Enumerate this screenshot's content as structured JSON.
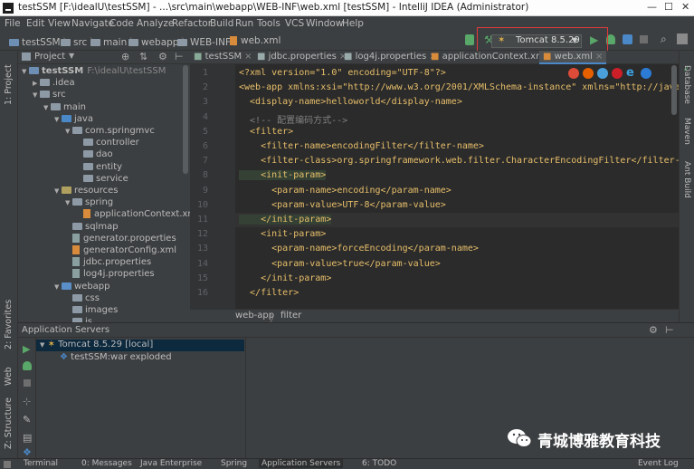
{
  "window": {
    "title": "testSSM [F:\\idealU\\testSSM] - ...\\src\\main\\webapp\\WEB-INF\\web.xml [testSSM] - IntelliJ IDEA (Administrator)"
  },
  "menu": [
    "File",
    "Edit",
    "View",
    "Navigate",
    "Code",
    "Analyze",
    "Refactor",
    "Build",
    "Run",
    "Tools",
    "VCS",
    "Window",
    "Help"
  ],
  "breadcrumbs": [
    "testSSM",
    "src",
    "main",
    "webapp",
    "WEB-INF",
    "web.xml"
  ],
  "run_config": {
    "label": "Tomcat 8.5.29"
  },
  "project_panel": {
    "title": "Project",
    "tree": [
      {
        "label": "testSSM",
        "suffix": "F:\\idealU\\testSSM",
        "indent": 0,
        "kind": "module",
        "open": true
      },
      {
        "label": ".idea",
        "indent": 1,
        "kind": "folder",
        "open": false
      },
      {
        "label": "src",
        "indent": 1,
        "kind": "folder",
        "open": true
      },
      {
        "label": "main",
        "indent": 2,
        "kind": "folder",
        "open": true
      },
      {
        "label": "java",
        "indent": 3,
        "kind": "src",
        "open": true
      },
      {
        "label": "com.springmvc",
        "indent": 4,
        "kind": "package",
        "open": true
      },
      {
        "label": "controller",
        "indent": 5,
        "kind": "package"
      },
      {
        "label": "dao",
        "indent": 5,
        "kind": "package"
      },
      {
        "label": "entity",
        "indent": 5,
        "kind": "package"
      },
      {
        "label": "service",
        "indent": 5,
        "kind": "package"
      },
      {
        "label": "resources",
        "indent": 3,
        "kind": "res",
        "open": true
      },
      {
        "label": "spring",
        "indent": 4,
        "kind": "folder",
        "open": true
      },
      {
        "label": "applicationContext.xml",
        "indent": 5,
        "kind": "xml"
      },
      {
        "label": "sqlmap",
        "indent": 4,
        "kind": "folder"
      },
      {
        "label": "generator.properties",
        "indent": 4,
        "kind": "prop"
      },
      {
        "label": "generatorConfig.xml",
        "indent": 4,
        "kind": "xml"
      },
      {
        "label": "jdbc.properties",
        "indent": 4,
        "kind": "prop"
      },
      {
        "label": "log4j.properties",
        "indent": 4,
        "kind": "prop"
      },
      {
        "label": "webapp",
        "indent": 3,
        "kind": "web",
        "open": true
      },
      {
        "label": "css",
        "indent": 4,
        "kind": "folder"
      },
      {
        "label": "images",
        "indent": 4,
        "kind": "folder"
      },
      {
        "label": "js",
        "indent": 4,
        "kind": "folder"
      }
    ]
  },
  "tabs": [
    {
      "label": "testSSM",
      "active": false
    },
    {
      "label": "jdbc.properties",
      "active": false
    },
    {
      "label": "log4j.properties",
      "active": false
    },
    {
      "label": "applicationContext.xml",
      "active": false
    },
    {
      "label": "web.xml",
      "active": true
    }
  ],
  "code": {
    "line_numbers": [
      "1",
      "2",
      "3",
      "4",
      "5",
      "6",
      "7",
      "8",
      "9",
      "10",
      "11",
      "12",
      "13",
      "14",
      "15",
      "16"
    ],
    "lines": [
      "<?xml version=\"1.0\" encoding=\"UTF-8\"?>",
      "<web-app xmlns:xsi=\"http://www.w3.org/2001/XMLSchema-instance\" xmlns=\"http://java.sun.com",
      "  <display-name>helloworld</display-name>",
      "  <!-- 配置编码方式-->",
      "  <filter>",
      "    <filter-name>encodingFilter</filter-name>",
      "    <filter-class>org.springframework.web.filter.CharacterEncodingFilter</filter-class>",
      "    <init-param>",
      "      <param-name>encoding</param-name>",
      "      <param-value>UTF-8</param-value>",
      "    </init-param>",
      "    <init-param>",
      "      <param-name>forceEncoding</param-name>",
      "      <param-value>true</param-value>",
      "    </init-param>",
      "  </filter>"
    ],
    "breadcrumb": [
      "web-app",
      "filter"
    ]
  },
  "right_stripe": [
    "Database",
    "Maven",
    "Ant Build"
  ],
  "left_stripe": [
    "1: Project",
    "2: Favorites",
    "Web",
    "Z: Structure"
  ],
  "servers": {
    "title": "Application Servers",
    "items": [
      {
        "label": "Tomcat 8.5.29 [local]",
        "indent": 0
      },
      {
        "label": "testSSM:war exploded",
        "indent": 1
      }
    ]
  },
  "statusbar": {
    "items": [
      "Terminal",
      "0: Messages",
      "Java Enterprise",
      "Spring",
      "Application Servers",
      "6: TODO"
    ],
    "right": "Event Log"
  },
  "watermark": {
    "text": "青城博雅教育科技"
  },
  "colors": {
    "accent_red": "#e03a3a",
    "run_green": "#59a869",
    "bg": "#3c3f41",
    "editor_bg": "#2b2b2b"
  }
}
